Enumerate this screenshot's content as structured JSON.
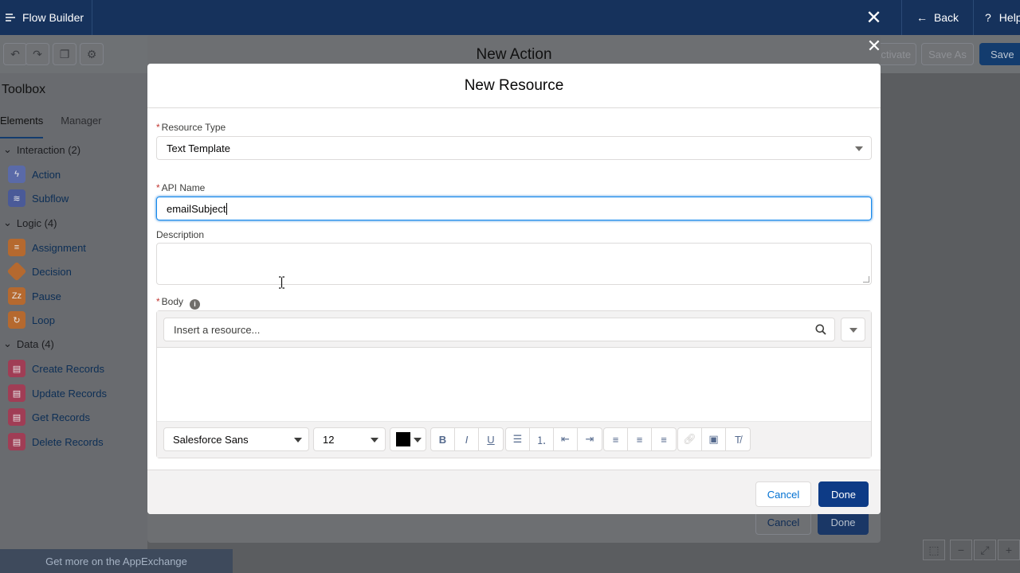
{
  "app": {
    "title": "Flow Builder",
    "back_label": "Back",
    "help_label": "Help"
  },
  "toolbar": {
    "activate_label": "Activate",
    "save_as_label": "Save As",
    "save_label": "Save"
  },
  "toolbox": {
    "title": "Toolbox",
    "tabs": [
      "Elements",
      "Manager"
    ],
    "sections": [
      {
        "label": "Interaction (2)",
        "items": [
          {
            "label": "Action",
            "icon": "lightning-icon",
            "color": "#5a6aa8"
          },
          {
            "label": "Subflow",
            "icon": "flow-icon",
            "color": "#4a5a98"
          }
        ]
      },
      {
        "label": "Logic (4)",
        "items": [
          {
            "label": "Assignment",
            "icon": "equals-icon",
            "color": "#b5692f"
          },
          {
            "label": "Decision",
            "icon": "diamond-icon",
            "color": "#b5692f"
          },
          {
            "label": "Pause",
            "icon": "zz-icon",
            "color": "#b5692f"
          },
          {
            "label": "Loop",
            "icon": "loop-icon",
            "color": "#b5692f"
          }
        ]
      },
      {
        "label": "Data (4)",
        "items": [
          {
            "label": "Create Records",
            "icon": "record-create-icon",
            "color": "#a03d55"
          },
          {
            "label": "Update Records",
            "icon": "record-update-icon",
            "color": "#a03d55"
          },
          {
            "label": "Get Records",
            "icon": "record-get-icon",
            "color": "#a03d55"
          },
          {
            "label": "Delete Records",
            "icon": "record-delete-icon",
            "color": "#a03d55"
          }
        ]
      }
    ],
    "appexchange_label": "Get more on the AppExchange"
  },
  "action_modal": {
    "title": "New Action",
    "cancel_label": "Cancel",
    "done_label": "Done"
  },
  "resource_modal": {
    "title": "New Resource",
    "resource_type": {
      "label": "Resource Type",
      "value": "Text Template"
    },
    "api_name": {
      "label": "API Name",
      "value": "emailSubject"
    },
    "description": {
      "label": "Description",
      "value": ""
    },
    "body": {
      "label": "Body",
      "resource_placeholder": "Insert a resource...",
      "font_family": "Salesforce Sans",
      "font_size": "12",
      "text_color": "#000000"
    },
    "cancel_label": "Cancel",
    "done_label": "Done"
  }
}
